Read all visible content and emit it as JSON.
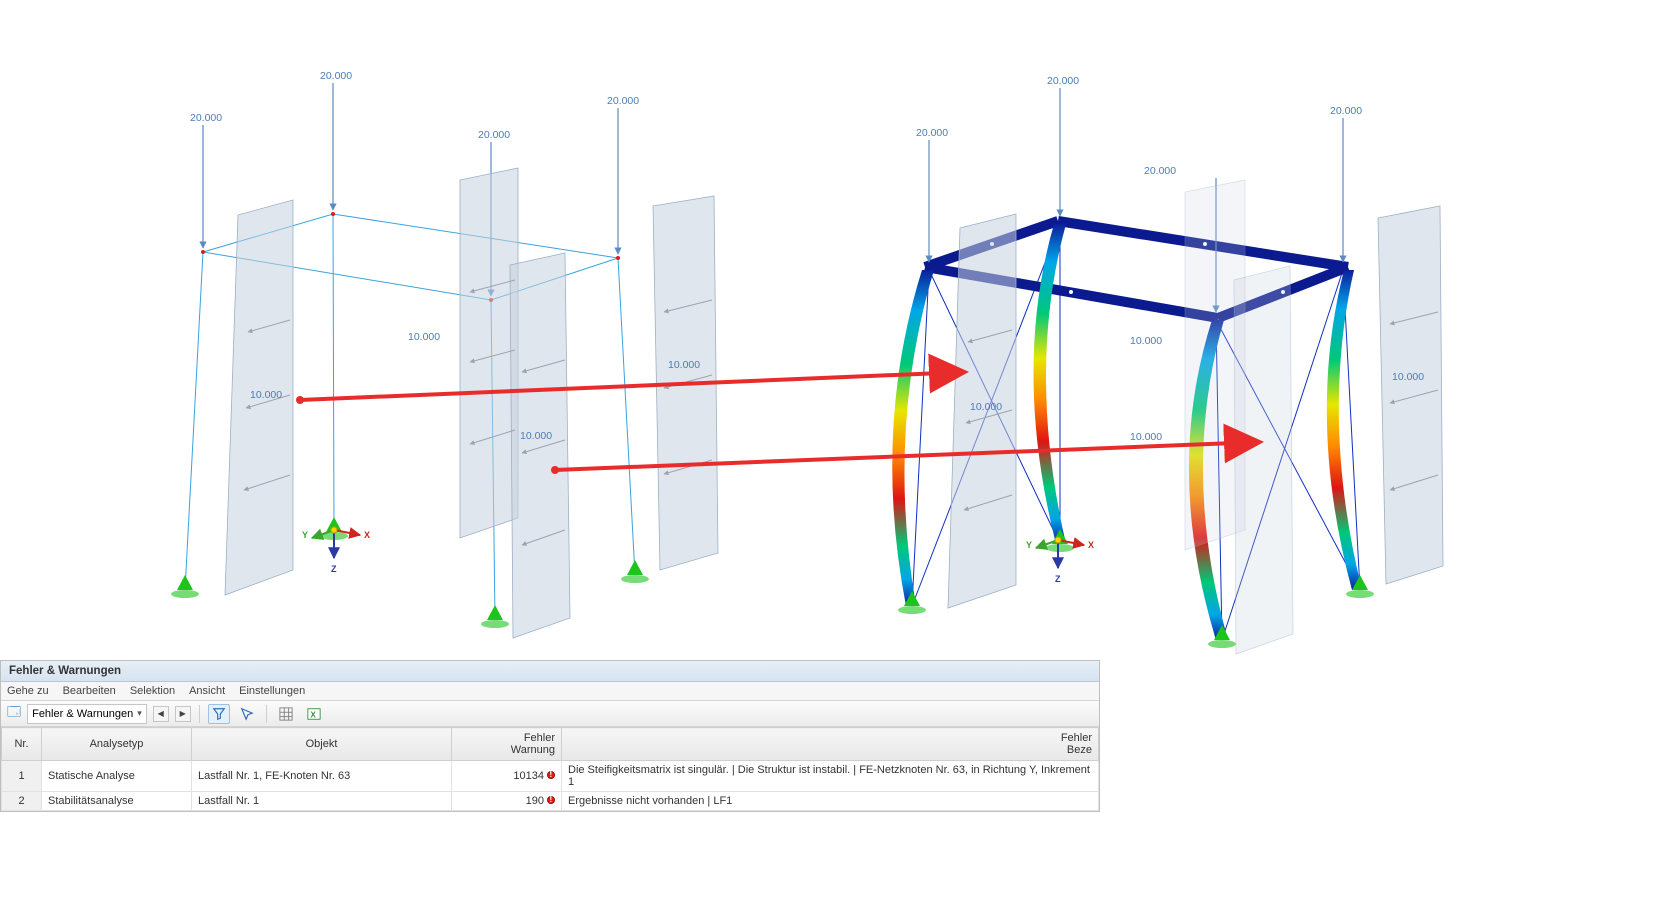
{
  "load_value": "20.000",
  "surface_load_value": "10.000",
  "axis": {
    "x": "X",
    "y": "Y",
    "z": "Z"
  },
  "panel": {
    "title": "Fehler & Warnungen",
    "menu": [
      "Gehe zu",
      "Bearbeiten",
      "Selektion",
      "Ansicht",
      "Einstellungen"
    ],
    "dropdown_label": "Fehler & Warnungen",
    "columns": {
      "nr": "Nr.",
      "type": "Analysetyp",
      "obj": "Objekt",
      "code": "Fehler\nWarnung",
      "desc": "Fehler\nBeze"
    },
    "rows": [
      {
        "nr": "1",
        "type": "Statische Analyse",
        "obj": "Lastfall Nr. 1, FE-Knoten Nr. 63",
        "code": "10134",
        "desc": "Die Steifigkeitsmatrix ist singulär. |  Die Struktur ist instabil. | FE-Netzknoten Nr. 63, in Richtung Y, Inkrement 1"
      },
      {
        "nr": "2",
        "type": "Stabilitätsanalyse",
        "obj": "Lastfall Nr. 1",
        "code": "190",
        "desc": "Ergebnisse nicht vorhanden | LF1"
      }
    ]
  }
}
